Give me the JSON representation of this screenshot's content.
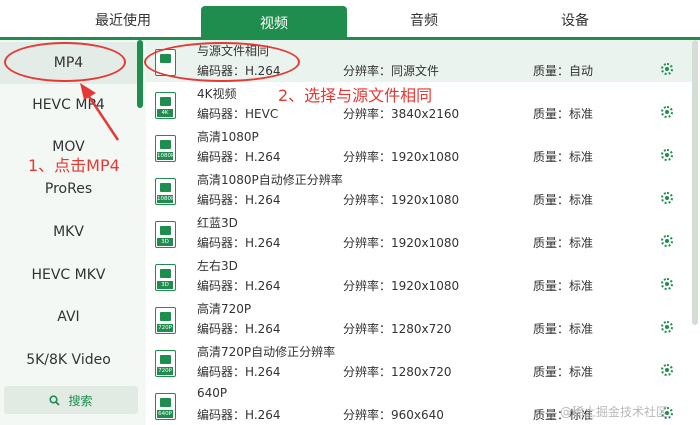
{
  "tabs": [
    {
      "label": "最近使用"
    },
    {
      "label": "视频"
    },
    {
      "label": "音频"
    },
    {
      "label": "设备"
    }
  ],
  "sidebar": {
    "items": [
      {
        "label": "MP4"
      },
      {
        "label": "HEVC MP4"
      },
      {
        "label": "MOV"
      },
      {
        "label": "ProRes"
      },
      {
        "label": "MKV"
      },
      {
        "label": "HEVC MKV"
      },
      {
        "label": "AVI"
      },
      {
        "label": "5K/8K Video"
      }
    ],
    "search_label": "搜索"
  },
  "presets": [
    {
      "name": "与源文件相同",
      "icon_tag": "",
      "encoder": "编码器：H.264",
      "resolution": "分辨率：同源文件",
      "quality": "质量：自动"
    },
    {
      "name": "4K视频",
      "icon_tag": "4K",
      "encoder": "编码器：HEVC",
      "resolution": "分辨率：3840x2160",
      "quality": "质量：标准"
    },
    {
      "name": "高清1080P",
      "icon_tag": "1080P",
      "encoder": "编码器：H.264",
      "resolution": "分辨率：1920x1080",
      "quality": "质量：标准"
    },
    {
      "name": "高清1080P自动修正分辨率",
      "icon_tag": "1080P",
      "encoder": "编码器：H.264",
      "resolution": "分辨率：1920x1080",
      "quality": "质量：标准"
    },
    {
      "name": "红蓝3D",
      "icon_tag": "3D",
      "encoder": "编码器：H.264",
      "resolution": "分辨率：1920x1080",
      "quality": "质量：标准"
    },
    {
      "name": "左右3D",
      "icon_tag": "3D",
      "encoder": "编码器：H.264",
      "resolution": "分辨率：1920x1080",
      "quality": "质量：标准"
    },
    {
      "name": "高清720P",
      "icon_tag": "720P",
      "encoder": "编码器：H.264",
      "resolution": "分辨率：1280x720",
      "quality": "质量：标准"
    },
    {
      "name": "高清720P自动修正分辨率",
      "icon_tag": "720P",
      "encoder": "编码器：H.264",
      "resolution": "分辨率：1280x720",
      "quality": "质量：标准"
    },
    {
      "name": "640P",
      "icon_tag": "640P",
      "encoder": "编码器：H.264",
      "resolution": "分辨率：960x640",
      "quality": "质量：标准"
    }
  ],
  "annotations": {
    "step1": "1、点击MP4",
    "step2": "2、选择与源文件相同"
  },
  "watermark": "@稀土掘金技术社区",
  "colors": {
    "accent": "#1f8d4d",
    "annotation": "#e53935"
  }
}
